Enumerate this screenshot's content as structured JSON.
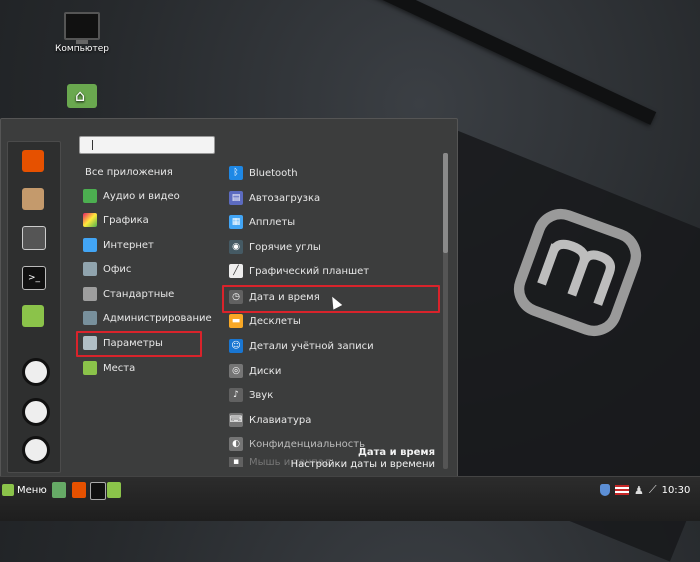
{
  "desktop": {
    "icons": [
      {
        "name": "computer",
        "label": "Компьютер"
      },
      {
        "name": "home",
        "label": ""
      }
    ]
  },
  "menu": {
    "search": {
      "value": "",
      "placeholder": ""
    },
    "categories": [
      {
        "label": "Все приложения",
        "icon": "none",
        "color": ""
      },
      {
        "label": "Аудио и видео",
        "icon": "audio-video-icon",
        "color": "#4caf50"
      },
      {
        "label": "Графика",
        "icon": "graphics-icon",
        "color": "#e91e63"
      },
      {
        "label": "Интернет",
        "icon": "internet-icon",
        "color": "#42a5f5"
      },
      {
        "label": "Офис",
        "icon": "office-icon",
        "color": "#90a4ae"
      },
      {
        "label": "Стандартные",
        "icon": "accessories-icon",
        "color": "#9e9e9e"
      },
      {
        "label": "Администрирование",
        "icon": "administration-icon",
        "color": "#78909c"
      },
      {
        "label": "Параметры",
        "icon": "preferences-icon",
        "color": "#b0bec5"
      },
      {
        "label": "Места",
        "icon": "folder-icon",
        "color": "#8bc34a"
      }
    ],
    "apps": [
      {
        "label": "Bluetooth",
        "icon": "bluetooth-icon",
        "color": "#1e88e5",
        "glyph": "ᛒ"
      },
      {
        "label": "Автозагрузка",
        "icon": "startup-icon",
        "color": "#5c6bc0",
        "glyph": "▤"
      },
      {
        "label": "Апплеты",
        "icon": "applets-icon",
        "color": "#42a5f5",
        "glyph": "▦"
      },
      {
        "label": "Горячие углы",
        "icon": "hot-corners-icon",
        "color": "#455a64",
        "glyph": "◉"
      },
      {
        "label": "Графический планшет",
        "icon": "tablet-icon",
        "color": "#eeeeee",
        "glyph": "╱"
      },
      {
        "label": "Дата и время",
        "icon": "date-time-icon",
        "color": "#616161",
        "glyph": "◷"
      },
      {
        "label": "Десклеты",
        "icon": "desklets-icon",
        "color": "#f9a825",
        "glyph": "▬"
      },
      {
        "label": "Детали учётной записи",
        "icon": "account-icon",
        "color": "#1976d2",
        "glyph": "☺"
      },
      {
        "label": "Диски",
        "icon": "disks-icon",
        "color": "#757575",
        "glyph": "◎"
      },
      {
        "label": "Звук",
        "icon": "sound-icon",
        "color": "#616161",
        "glyph": "♪"
      },
      {
        "label": "Клавиатура",
        "icon": "keyboard-icon",
        "color": "#757575",
        "glyph": "⌨"
      },
      {
        "label": "Конфиденциальность",
        "icon": "privacy-icon",
        "color": "#757575",
        "glyph": "◐"
      },
      {
        "label": "Мышь и тачпад",
        "icon": "mouse-icon",
        "color": "#616161",
        "glyph": "▪"
      }
    ],
    "description": {
      "title": "Дата и время",
      "subtitle": "Настройки даты и времени"
    }
  },
  "taskbar": {
    "menu_label": "Меню",
    "time": "10:30"
  },
  "colors": {
    "highlight": "#d9232b",
    "accent": "#8bc34a"
  }
}
